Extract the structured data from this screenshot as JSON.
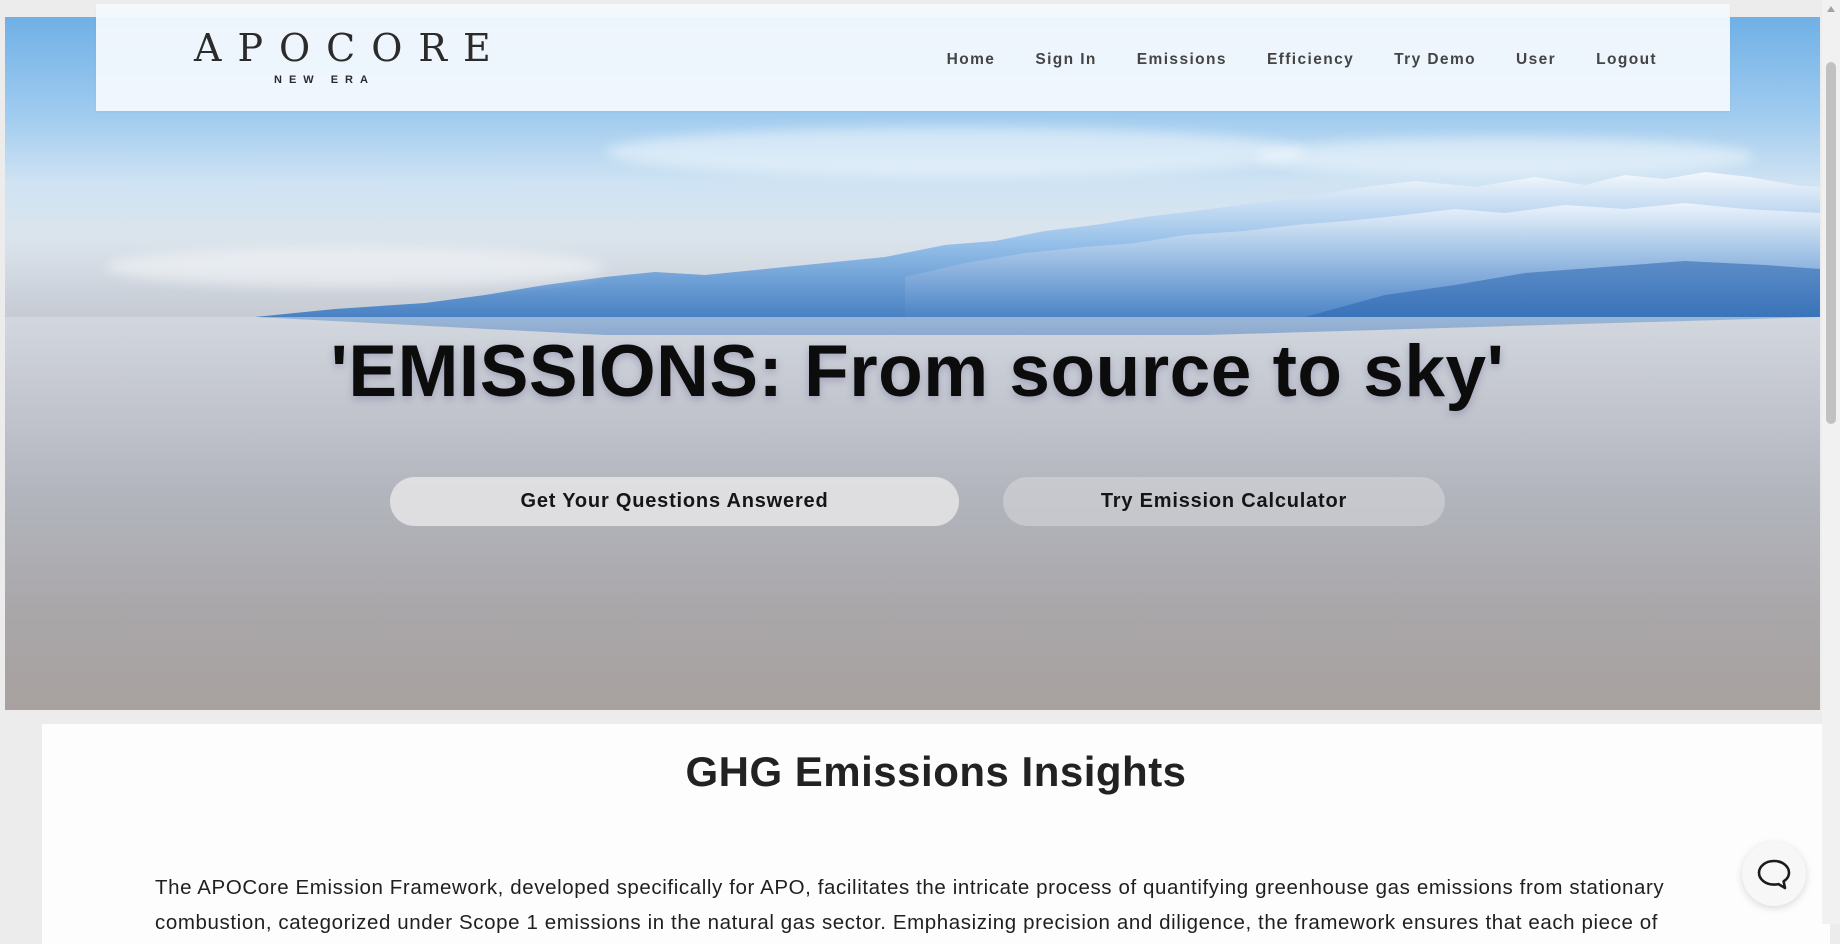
{
  "logo": {
    "main": "APOCORE",
    "sub": "NEW ERA"
  },
  "nav": {
    "items": [
      {
        "label": "Home"
      },
      {
        "label": "Sign In"
      },
      {
        "label": "Emissions"
      },
      {
        "label": "Efficiency"
      },
      {
        "label": "Try Demo"
      },
      {
        "label": "User"
      },
      {
        "label": "Logout"
      }
    ]
  },
  "hero": {
    "headline": "'EMISSIONS: From source to sky'",
    "buttons": {
      "questions": "Get Your Questions Answered",
      "calculator": "Try Emission Calculator"
    }
  },
  "insights": {
    "title": "GHG Emissions Insights",
    "body": "The APOCore Emission Framework, developed specifically for APO, facilitates the intricate process of quantifying greenhouse gas emissions from stationary combustion, categorized under Scope 1 emissions in the natural gas sector. Emphasizing precision and diligence, the framework ensures that each piece of"
  },
  "icons": {
    "chat": "chat-bubble-icon"
  }
}
